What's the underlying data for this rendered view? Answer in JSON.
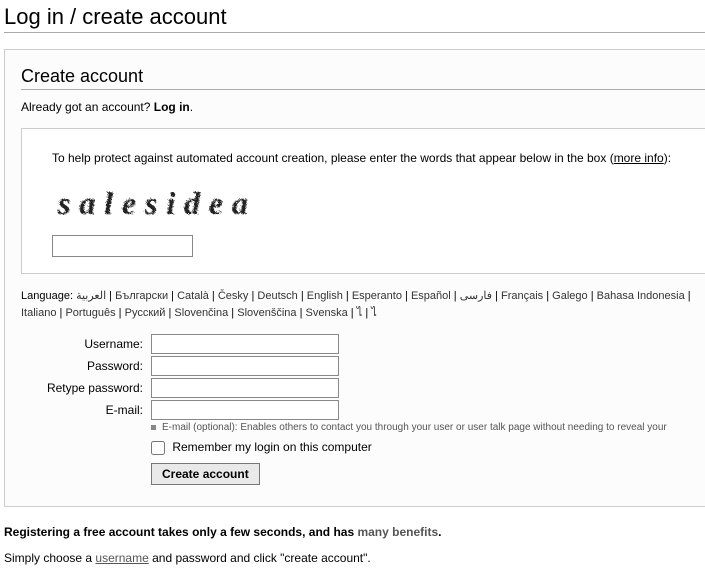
{
  "pageTitle": "Log in / create account",
  "sectionHeading": "Create account",
  "loginPrompt": {
    "prefix": "Already got an account? ",
    "link": "Log in"
  },
  "captcha": {
    "instruction": "To help protect against automated account creation, please enter the words that appear below in the box (",
    "moreInfo": "more info",
    "instructionSuffix": "):",
    "word": "salesidea"
  },
  "language": {
    "label": "Language: ",
    "items": [
      "العربية",
      "Български",
      "Català",
      "Česky",
      "Deutsch",
      "English",
      "Esperanto",
      "Español",
      "فارسی",
      "Français",
      "Galego",
      "Bahasa Indonesia",
      "Italiano",
      "Português",
      "Русский",
      "Slovenčina",
      "Slovenščina",
      "Svenska",
      "ไ",
      "ไ"
    ]
  },
  "fields": {
    "usernameLabel": "Username:",
    "passwordLabel": "Password:",
    "retypeLabel": "Retype password:",
    "emailLabel": "E-mail:",
    "emailNote": "E-mail (optional): Enables others to contact you through your user or user talk page without needing to reveal your",
    "rememberLabel": "Remember my login on this computer",
    "submitLabel": "Create account"
  },
  "footer": {
    "benefitsPrefix": "Registering a free account takes only a few seconds, and has ",
    "benefitsLink": "many benefits",
    "benefitsSuffix": ".",
    "choosePrefix": "Simply choose a ",
    "username": "username",
    "chooseSuffix": " and password and click \"create account\"."
  }
}
